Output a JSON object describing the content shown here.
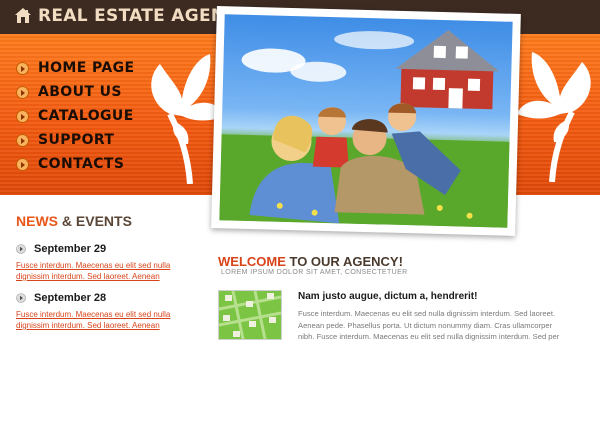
{
  "header": {
    "title": "REAL ESTATE AGENCY",
    "logo_icon": "house-icon"
  },
  "nav": {
    "items": [
      {
        "label": "HOME PAGE"
      },
      {
        "label": "ABOUT US"
      },
      {
        "label": "CATALOGUE"
      },
      {
        "label": "SUPPORT"
      },
      {
        "label": "CONTACTS"
      }
    ]
  },
  "news": {
    "heading_accent": "NEWS",
    "heading_rest": " & EVENTS",
    "items": [
      {
        "date": "September 29",
        "text": "Fusce interdum. Maecenas eu elit sed nulla dignissim interdum. Sed laoreet. Aenean"
      },
      {
        "date": "September 28",
        "text": "Fusce interdum. Maecenas eu elit sed nulla dignissim interdum. Sed laoreet. Aenean"
      }
    ]
  },
  "welcome": {
    "title_accent": "WELCOME",
    "title_rest": " TO OUR AGENCY!",
    "subtitle": "LOREM IPSUM DOLOR SIT AMET, CONSECTETUER",
    "article_title": "Nam justo augue, dictum a, hendrerit!",
    "article_text": "Fusce interdum. Maecenas eu elit sed nulla dignissim interdum. Sed laoreet. Aenean pede. Phasellus porta. Ut dictum nonummy diam. Cras ullamcorper nibh. Fusce interdum. Maecenas eu elit sed nulla dignissim interdum. Sed per"
  },
  "colors": {
    "topbar": "#3d2b22",
    "banner": "#f35a10",
    "accent": "#d8441a",
    "title_text": "#f2ddc2"
  }
}
